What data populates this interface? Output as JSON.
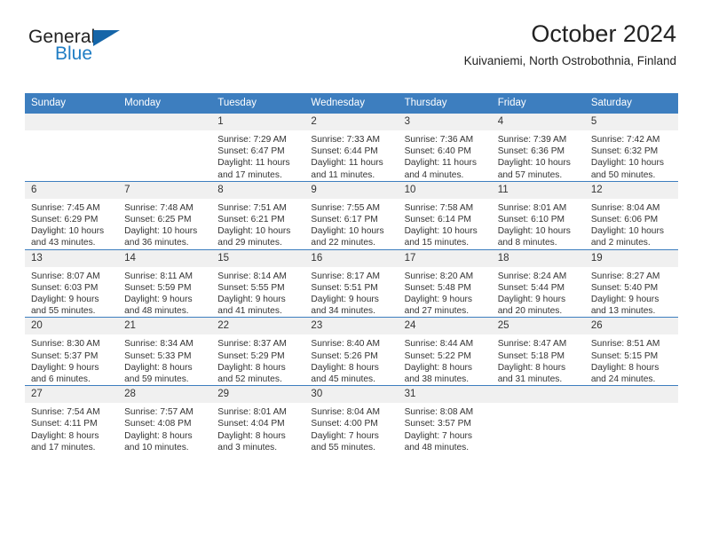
{
  "brand": {
    "line1": "General",
    "line2": "Blue",
    "accent_color": "#1f7dc4",
    "triangle_color": "#1565a8"
  },
  "header": {
    "title": "October 2024",
    "subtitle": "Kuivaniemi, North Ostrobothnia, Finland"
  },
  "theme": {
    "header_bg": "#3d7ebf",
    "daynum_bg": "#f0f0f0",
    "text": "#333333"
  },
  "weekday_headers": [
    "Sunday",
    "Monday",
    "Tuesday",
    "Wednesday",
    "Thursday",
    "Friday",
    "Saturday"
  ],
  "labels": {
    "sunrise": "Sunrise:",
    "sunset": "Sunset:",
    "daylight": "Daylight:"
  },
  "weeks": [
    [
      {
        "day": "",
        "sunrise": "",
        "sunset": "",
        "daylight_a": "",
        "daylight_b": ""
      },
      {
        "day": "",
        "sunrise": "",
        "sunset": "",
        "daylight_a": "",
        "daylight_b": ""
      },
      {
        "day": "1",
        "sunrise": "Sunrise: 7:29 AM",
        "sunset": "Sunset: 6:47 PM",
        "daylight_a": "Daylight: 11 hours",
        "daylight_b": "and 17 minutes."
      },
      {
        "day": "2",
        "sunrise": "Sunrise: 7:33 AM",
        "sunset": "Sunset: 6:44 PM",
        "daylight_a": "Daylight: 11 hours",
        "daylight_b": "and 11 minutes."
      },
      {
        "day": "3",
        "sunrise": "Sunrise: 7:36 AM",
        "sunset": "Sunset: 6:40 PM",
        "daylight_a": "Daylight: 11 hours",
        "daylight_b": "and 4 minutes."
      },
      {
        "day": "4",
        "sunrise": "Sunrise: 7:39 AM",
        "sunset": "Sunset: 6:36 PM",
        "daylight_a": "Daylight: 10 hours",
        "daylight_b": "and 57 minutes."
      },
      {
        "day": "5",
        "sunrise": "Sunrise: 7:42 AM",
        "sunset": "Sunset: 6:32 PM",
        "daylight_a": "Daylight: 10 hours",
        "daylight_b": "and 50 minutes."
      }
    ],
    [
      {
        "day": "6",
        "sunrise": "Sunrise: 7:45 AM",
        "sunset": "Sunset: 6:29 PM",
        "daylight_a": "Daylight: 10 hours",
        "daylight_b": "and 43 minutes."
      },
      {
        "day": "7",
        "sunrise": "Sunrise: 7:48 AM",
        "sunset": "Sunset: 6:25 PM",
        "daylight_a": "Daylight: 10 hours",
        "daylight_b": "and 36 minutes."
      },
      {
        "day": "8",
        "sunrise": "Sunrise: 7:51 AM",
        "sunset": "Sunset: 6:21 PM",
        "daylight_a": "Daylight: 10 hours",
        "daylight_b": "and 29 minutes."
      },
      {
        "day": "9",
        "sunrise": "Sunrise: 7:55 AM",
        "sunset": "Sunset: 6:17 PM",
        "daylight_a": "Daylight: 10 hours",
        "daylight_b": "and 22 minutes."
      },
      {
        "day": "10",
        "sunrise": "Sunrise: 7:58 AM",
        "sunset": "Sunset: 6:14 PM",
        "daylight_a": "Daylight: 10 hours",
        "daylight_b": "and 15 minutes."
      },
      {
        "day": "11",
        "sunrise": "Sunrise: 8:01 AM",
        "sunset": "Sunset: 6:10 PM",
        "daylight_a": "Daylight: 10 hours",
        "daylight_b": "and 8 minutes."
      },
      {
        "day": "12",
        "sunrise": "Sunrise: 8:04 AM",
        "sunset": "Sunset: 6:06 PM",
        "daylight_a": "Daylight: 10 hours",
        "daylight_b": "and 2 minutes."
      }
    ],
    [
      {
        "day": "13",
        "sunrise": "Sunrise: 8:07 AM",
        "sunset": "Sunset: 6:03 PM",
        "daylight_a": "Daylight: 9 hours",
        "daylight_b": "and 55 minutes."
      },
      {
        "day": "14",
        "sunrise": "Sunrise: 8:11 AM",
        "sunset": "Sunset: 5:59 PM",
        "daylight_a": "Daylight: 9 hours",
        "daylight_b": "and 48 minutes."
      },
      {
        "day": "15",
        "sunrise": "Sunrise: 8:14 AM",
        "sunset": "Sunset: 5:55 PM",
        "daylight_a": "Daylight: 9 hours",
        "daylight_b": "and 41 minutes."
      },
      {
        "day": "16",
        "sunrise": "Sunrise: 8:17 AM",
        "sunset": "Sunset: 5:51 PM",
        "daylight_a": "Daylight: 9 hours",
        "daylight_b": "and 34 minutes."
      },
      {
        "day": "17",
        "sunrise": "Sunrise: 8:20 AM",
        "sunset": "Sunset: 5:48 PM",
        "daylight_a": "Daylight: 9 hours",
        "daylight_b": "and 27 minutes."
      },
      {
        "day": "18",
        "sunrise": "Sunrise: 8:24 AM",
        "sunset": "Sunset: 5:44 PM",
        "daylight_a": "Daylight: 9 hours",
        "daylight_b": "and 20 minutes."
      },
      {
        "day": "19",
        "sunrise": "Sunrise: 8:27 AM",
        "sunset": "Sunset: 5:40 PM",
        "daylight_a": "Daylight: 9 hours",
        "daylight_b": "and 13 minutes."
      }
    ],
    [
      {
        "day": "20",
        "sunrise": "Sunrise: 8:30 AM",
        "sunset": "Sunset: 5:37 PM",
        "daylight_a": "Daylight: 9 hours",
        "daylight_b": "and 6 minutes."
      },
      {
        "day": "21",
        "sunrise": "Sunrise: 8:34 AM",
        "sunset": "Sunset: 5:33 PM",
        "daylight_a": "Daylight: 8 hours",
        "daylight_b": "and 59 minutes."
      },
      {
        "day": "22",
        "sunrise": "Sunrise: 8:37 AM",
        "sunset": "Sunset: 5:29 PM",
        "daylight_a": "Daylight: 8 hours",
        "daylight_b": "and 52 minutes."
      },
      {
        "day": "23",
        "sunrise": "Sunrise: 8:40 AM",
        "sunset": "Sunset: 5:26 PM",
        "daylight_a": "Daylight: 8 hours",
        "daylight_b": "and 45 minutes."
      },
      {
        "day": "24",
        "sunrise": "Sunrise: 8:44 AM",
        "sunset": "Sunset: 5:22 PM",
        "daylight_a": "Daylight: 8 hours",
        "daylight_b": "and 38 minutes."
      },
      {
        "day": "25",
        "sunrise": "Sunrise: 8:47 AM",
        "sunset": "Sunset: 5:18 PM",
        "daylight_a": "Daylight: 8 hours",
        "daylight_b": "and 31 minutes."
      },
      {
        "day": "26",
        "sunrise": "Sunrise: 8:51 AM",
        "sunset": "Sunset: 5:15 PM",
        "daylight_a": "Daylight: 8 hours",
        "daylight_b": "and 24 minutes."
      }
    ],
    [
      {
        "day": "27",
        "sunrise": "Sunrise: 7:54 AM",
        "sunset": "Sunset: 4:11 PM",
        "daylight_a": "Daylight: 8 hours",
        "daylight_b": "and 17 minutes."
      },
      {
        "day": "28",
        "sunrise": "Sunrise: 7:57 AM",
        "sunset": "Sunset: 4:08 PM",
        "daylight_a": "Daylight: 8 hours",
        "daylight_b": "and 10 minutes."
      },
      {
        "day": "29",
        "sunrise": "Sunrise: 8:01 AM",
        "sunset": "Sunset: 4:04 PM",
        "daylight_a": "Daylight: 8 hours",
        "daylight_b": "and 3 minutes."
      },
      {
        "day": "30",
        "sunrise": "Sunrise: 8:04 AM",
        "sunset": "Sunset: 4:00 PM",
        "daylight_a": "Daylight: 7 hours",
        "daylight_b": "and 55 minutes."
      },
      {
        "day": "31",
        "sunrise": "Sunrise: 8:08 AM",
        "sunset": "Sunset: 3:57 PM",
        "daylight_a": "Daylight: 7 hours",
        "daylight_b": "and 48 minutes."
      },
      {
        "day": "",
        "sunrise": "",
        "sunset": "",
        "daylight_a": "",
        "daylight_b": ""
      },
      {
        "day": "",
        "sunrise": "",
        "sunset": "",
        "daylight_a": "",
        "daylight_b": ""
      }
    ]
  ]
}
